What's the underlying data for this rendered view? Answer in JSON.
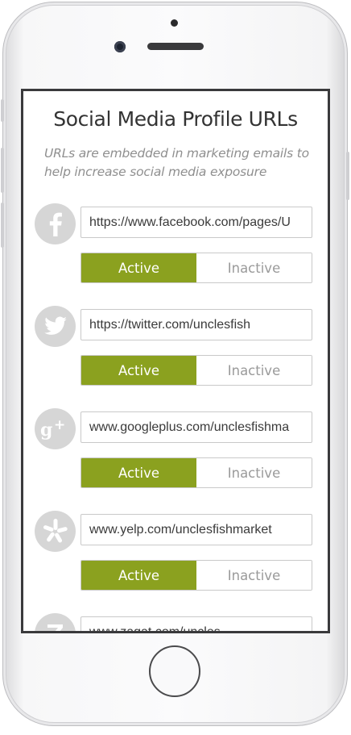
{
  "page": {
    "title": "Social Media Profile URLs",
    "subtitle": "URLs are embedded in marketing emails to help increase social media exposure"
  },
  "profiles": [
    {
      "network": "facebook",
      "icon": "facebook-icon",
      "url": "https://www.facebook.com/pages/U",
      "active_label": "Active",
      "inactive_label": "Inactive",
      "status": "active"
    },
    {
      "network": "twitter",
      "icon": "twitter-icon",
      "url": "https://twitter.com/unclesfish",
      "active_label": "Active",
      "inactive_label": "Inactive",
      "status": "active"
    },
    {
      "network": "googleplus",
      "icon": "google-plus-icon",
      "url": "www.googleplus.com/unclesfishma",
      "active_label": "Active",
      "inactive_label": "Inactive",
      "status": "active"
    },
    {
      "network": "yelp",
      "icon": "yelp-icon",
      "url": "www.yelp.com/unclesfishmarket",
      "active_label": "Active",
      "inactive_label": "Inactive",
      "status": "active"
    },
    {
      "network": "zagat",
      "icon": "zagat-icon",
      "url": "www.zagat.com/uncles"
    }
  ],
  "colors": {
    "active": "#8ba11f",
    "icon_bg": "#d6d6d6"
  }
}
